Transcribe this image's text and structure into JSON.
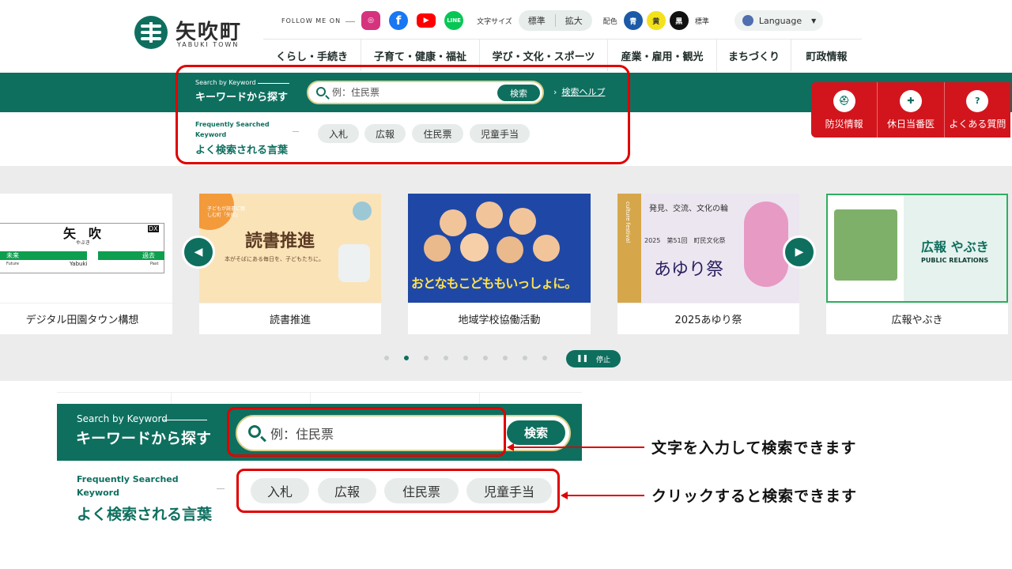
{
  "header": {
    "logo_jp": "矢吹町",
    "logo_en": "YABUKI TOWN",
    "follow_label": "FOLLOW ME ON",
    "sns": [
      "Instagram",
      "Facebook",
      "YouTube",
      "LINE"
    ],
    "text_size_label": "文字サイズ",
    "text_size_options": [
      "標準",
      "拡大"
    ],
    "color_label": "配色",
    "color_options": [
      "青",
      "黄",
      "黒"
    ],
    "color_standard": "標準",
    "language_label": "Language",
    "colors": {
      "brand_green": "#0e6f5f",
      "accent_red": "#d2151c"
    }
  },
  "nav": [
    "くらし・手続き",
    "子育て・健康・福祉",
    "学び・文化・スポーツ",
    "産業・雇用・観光",
    "まちづくり",
    "町政情報"
  ],
  "search": {
    "sub_label": "Search by Keyword",
    "title": "キーワードから探す",
    "placeholder": "例：住民票",
    "button": "検索",
    "help": "検索ヘルプ",
    "frequent_sub_line1": "Frequently Searched",
    "frequent_sub_line2": "Keyword",
    "frequent_title": "よく検索される言葉",
    "keywords": [
      "入札",
      "広報",
      "住民票",
      "児童手当"
    ]
  },
  "quick_links": [
    "防災情報",
    "休日当番医",
    "よくある質問"
  ],
  "carousel": {
    "slides": [
      {
        "caption": "デジタル田園タウン構想",
        "sign_name": "矢　吹",
        "sign_reading": "やぶき",
        "sign_left": "未来",
        "sign_right": "過去",
        "sign_left_en": "Future",
        "sign_mid_en": "Yabuki",
        "sign_right_en": "Past",
        "sign_badge": "DX"
      },
      {
        "caption": "読書推進",
        "heading": "読書推進",
        "note": "子どもが読書に親しむ町「矢吹」",
        "sub": "本がそばにある毎日を、子どもたちに。"
      },
      {
        "caption": "地域学校協働活動",
        "banner": "おとなもこどももいっしょに。"
      },
      {
        "caption": "2025あゆり祭",
        "line1": "発見、交流、文化の輪",
        "line2": "2025　第51回　町民文化祭",
        "title": "あゆり祭",
        "vertical": "culture festival"
      },
      {
        "caption": "広報やぶき",
        "logo": "広報 やぶき",
        "sub": "PUBLIC RELATIONS"
      }
    ],
    "dots_total": 9,
    "active_dot": 2,
    "pause_label": "停止"
  },
  "annotations": {
    "input_note": "文字を入力して検索できます",
    "click_note": "クリックすると検索できます"
  }
}
